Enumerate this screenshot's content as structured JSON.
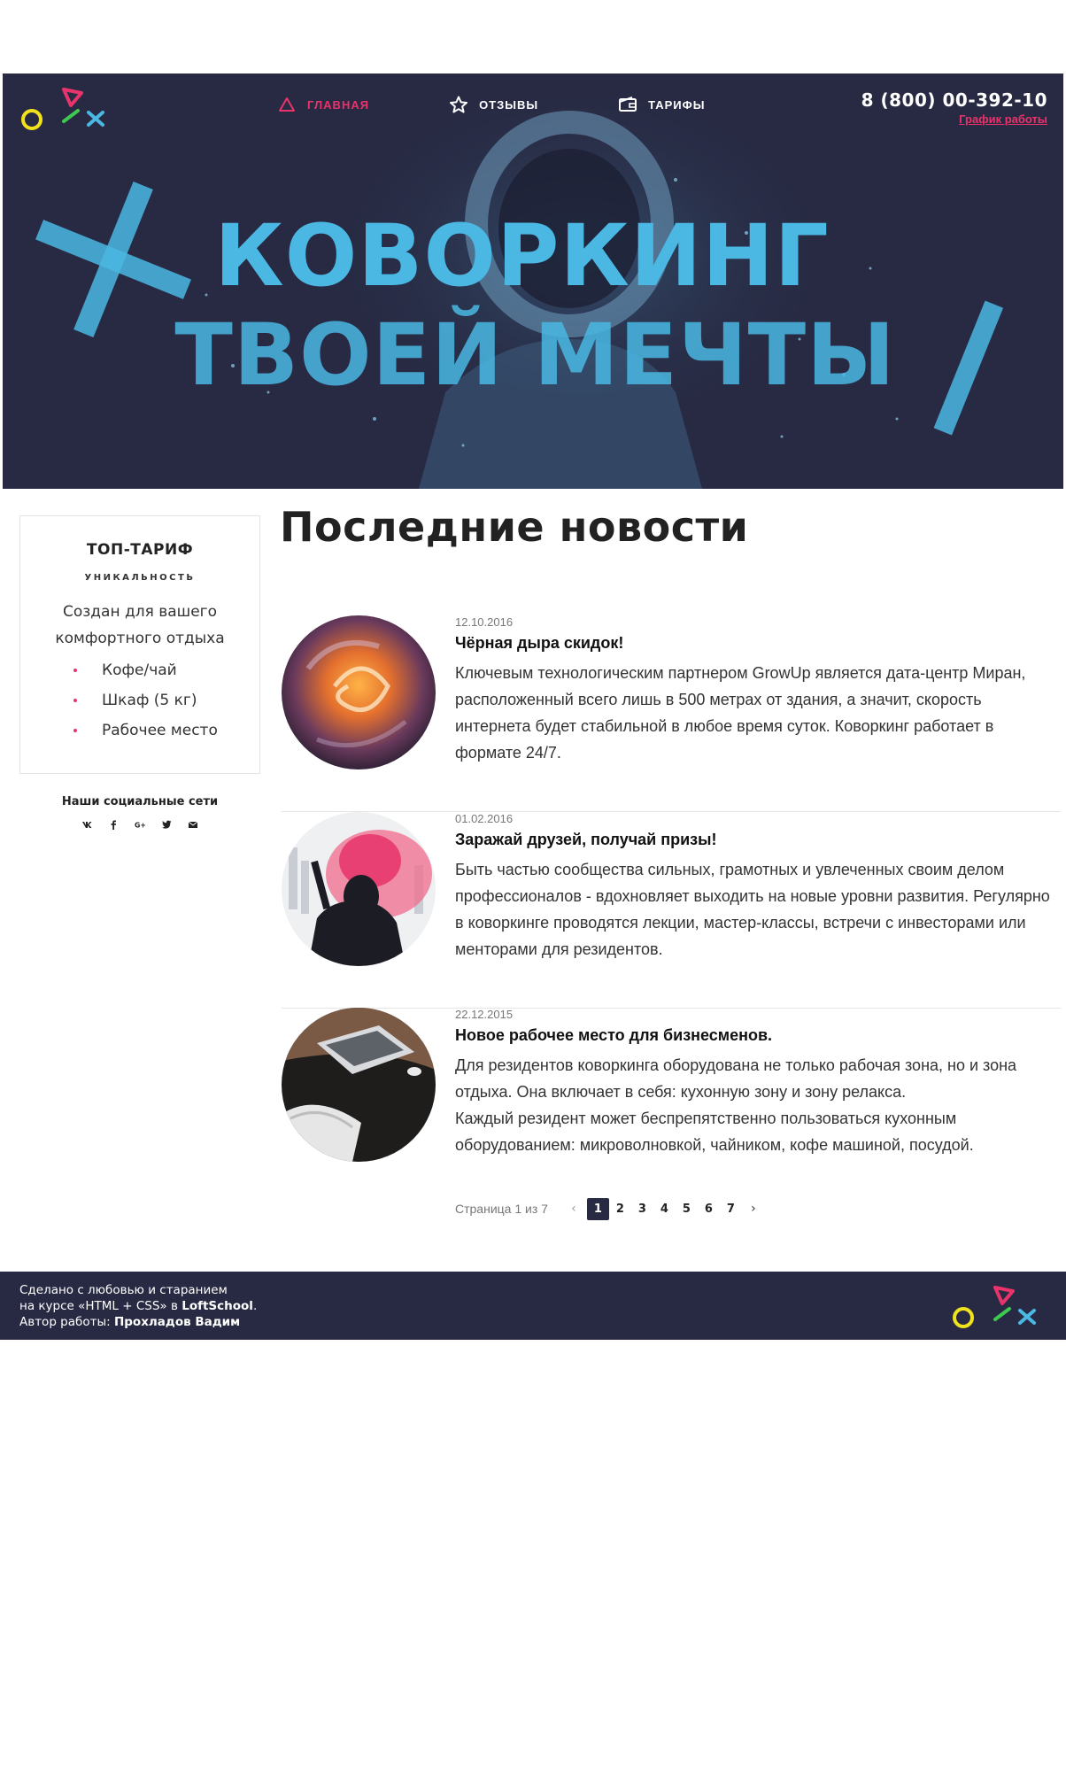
{
  "nav": {
    "items": [
      {
        "label": "ГЛАВНАЯ",
        "icon": "triangle-icon",
        "active": true
      },
      {
        "label": "ОТЗЫВЫ",
        "icon": "star-icon",
        "active": false
      },
      {
        "label": "ТАРИФЫ",
        "icon": "wallet-icon",
        "active": false
      }
    ]
  },
  "header": {
    "phone": "8 (800) 00-392-10",
    "schedule_link": "График работы"
  },
  "hero": {
    "line1": "Коворкинг",
    "line2": "твоей мечты"
  },
  "tariff": {
    "title": "ТОП-ТАРИФ",
    "subtitle": "УНИКАЛЬНОСТЬ",
    "description": "Создан для вашего комфортного отдыха",
    "features": [
      "Кофе/чай",
      "Шкаф (5 кг)",
      "Рабочее место"
    ]
  },
  "social": {
    "title": "Наши социальные сети",
    "icons": [
      "vk-icon",
      "facebook-icon",
      "google-plus-icon",
      "twitter-icon",
      "mail-icon"
    ]
  },
  "news": {
    "title": "Последние новости",
    "items": [
      {
        "date": "12.10.2016",
        "headline": "Чёрная дыра скидок!",
        "text": "Ключевым технологическим партнером GrowUp является дата-центр Миран, расположенный всего лишь в 500 метрах от здания, а значит, скорость интернета будет стабильной в любое время суток. Коворкинг работает в формате 24/7.",
        "image": "smoke-swirl-image"
      },
      {
        "date": "01.02.2016",
        "headline": "Заражай друзей, получай призы!",
        "text": "Быть частью сообщества сильных, грамотных и увлеченных своим делом профессионалов - вдохновляет выходить на новые уровни развития. Регулярно в коворкинге проводятся лекции, мастер-классы, встречи с инвесторами или менторами для резидентов.",
        "image": "flare-person-image"
      },
      {
        "date": "22.12.2015",
        "headline": "Новое рабочее место для бизнесменов.",
        "text": "Для резидентов коворкинга оборудована не только рабочая зона, но и зона отдыха. Она включает в себя: кухонную зону и зону релакса.\nКаждый резидент может беспрепятственно пользоваться кухонным оборудованием: микроволновкой, чайником, кофе машиной, посудой.",
        "image": "laptop-desk-image"
      }
    ]
  },
  "pagination": {
    "label": "Страница 1 из 7",
    "pages": [
      "1",
      "2",
      "3",
      "4",
      "5",
      "6",
      "7"
    ],
    "current": "1",
    "prev": "‹",
    "next": "›"
  },
  "footer": {
    "line1": "Сделано с любовью и старанием",
    "line2_prefix": "на курсе «HTML + CSS» в ",
    "line2_brand": "LoftSchool",
    "line2_suffix": ".",
    "line3_prefix": "Автор работы: ",
    "line3_author": "Прохладов Вадим"
  },
  "colors": {
    "dark": "#282a43",
    "accent_pink": "#e8336b",
    "hero_blue": "#4ab8e3",
    "logo_yellow": "#f2e21c",
    "logo_green": "#3ec94f",
    "logo_blue": "#4ab8e3"
  }
}
